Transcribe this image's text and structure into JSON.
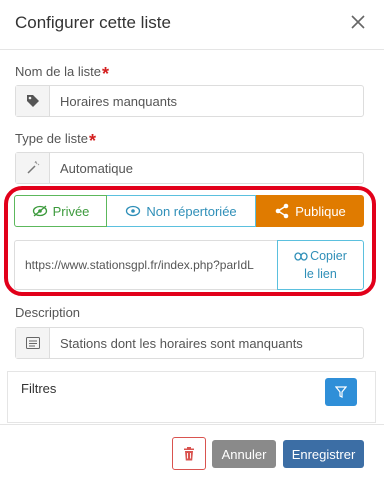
{
  "header": {
    "title": "Configurer cette liste"
  },
  "name_field": {
    "label": "Nom de la liste",
    "required_mark": "*",
    "value": "Horaires manquants",
    "icon": "tag-icon"
  },
  "type_field": {
    "label": "Type de liste",
    "required_mark": "*",
    "value": "Automatique",
    "icon": "magic-wand-icon"
  },
  "visibility": {
    "options": [
      {
        "label": "Privée",
        "icon": "eye-slash-icon"
      },
      {
        "label": "Non répertoriée",
        "icon": "eye-icon"
      },
      {
        "label": "Publique",
        "icon": "share-icon"
      }
    ],
    "selected": "Publique",
    "url": "https://www.stationsgpl.fr/index.php?parIdL",
    "copy_label_line1": "Copier",
    "copy_label_line2": "le lien"
  },
  "description_field": {
    "label": "Description",
    "value": "Stations dont les horaires sont manquants",
    "icon": "list-icon"
  },
  "filters": {
    "label": "Filtres",
    "icon": "filter-icon"
  },
  "footer": {
    "delete_icon": "trash-icon",
    "cancel_label": "Annuler",
    "save_label": "Enregistrer"
  },
  "colors": {
    "private": "#5cb85c",
    "unlisted": "#5bc0de",
    "public": "#e07b00",
    "highlight": "#e2001a",
    "save": "#3c6ea5",
    "cancel": "#8a8a8a",
    "filter": "#2f8fd8"
  }
}
